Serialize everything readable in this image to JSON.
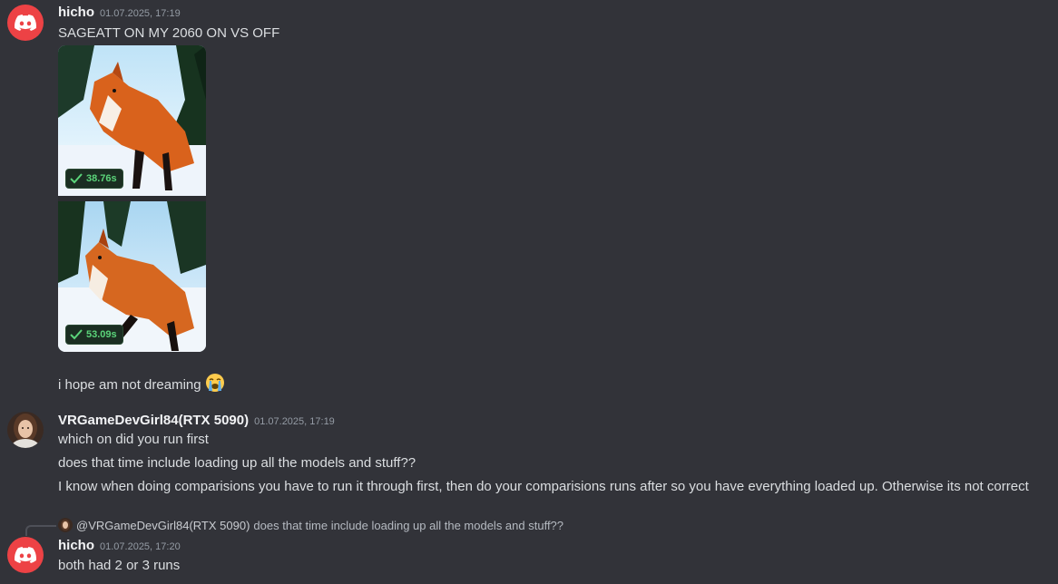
{
  "messages": [
    {
      "username": "hicho",
      "timestamp": "01.07.2025, 17:19",
      "text": "SAGEATT ON MY 2060 ON VS OFF",
      "images": [
        {
          "badge": "38.76s"
        },
        {
          "badge": "53.09s"
        }
      ],
      "followup": "i hope am not dreaming",
      "emoji": "loudly-crying-face-icon"
    },
    {
      "username": "VRGameDevGirl84(RTX 5090)",
      "timestamp": "01.07.2025, 17:19",
      "lines": [
        "which on did you run first",
        "does that time include loading up all the models and stuff??",
        "I know when doing comparisions you have to run it through first, then do your comparisions runs after so you have everything loaded up. Otherwise its not correct"
      ]
    },
    {
      "reply_to": {
        "mention": "@VRGameDevGirl84(RTX 5090)",
        "text": "does that time include loading up all the models and stuff??"
      },
      "username": "hicho",
      "timestamp": "01.07.2025, 17:20",
      "text": "both had 2 or 3 runs"
    }
  ],
  "colors": {
    "background": "#323339",
    "discord_red": "#ed4245",
    "badge_green": "#5bd47a"
  }
}
